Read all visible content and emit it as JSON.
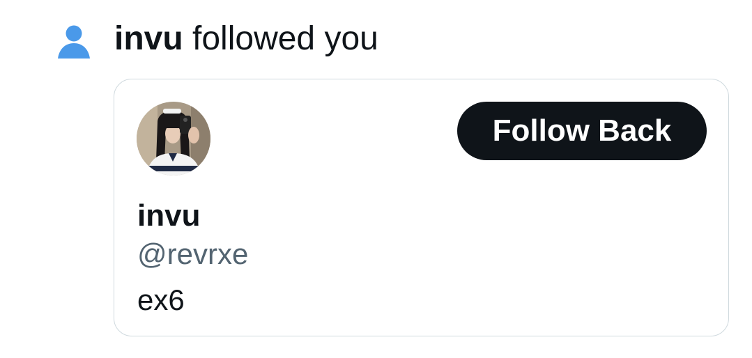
{
  "notification": {
    "actor_name": "invu",
    "action_text": " followed you",
    "icon": "person-icon",
    "icon_color": "#4a99e9"
  },
  "profile_card": {
    "display_name": "invu",
    "handle": "@revrxe",
    "bio": "ex6",
    "follow_back_label": "Follow Back",
    "avatar": "profile-photo"
  },
  "colors": {
    "text_primary": "#0f1419",
    "text_secondary": "#536471",
    "button_bg": "#0f1419",
    "button_text": "#ffffff",
    "card_border": "#cfd9de"
  }
}
